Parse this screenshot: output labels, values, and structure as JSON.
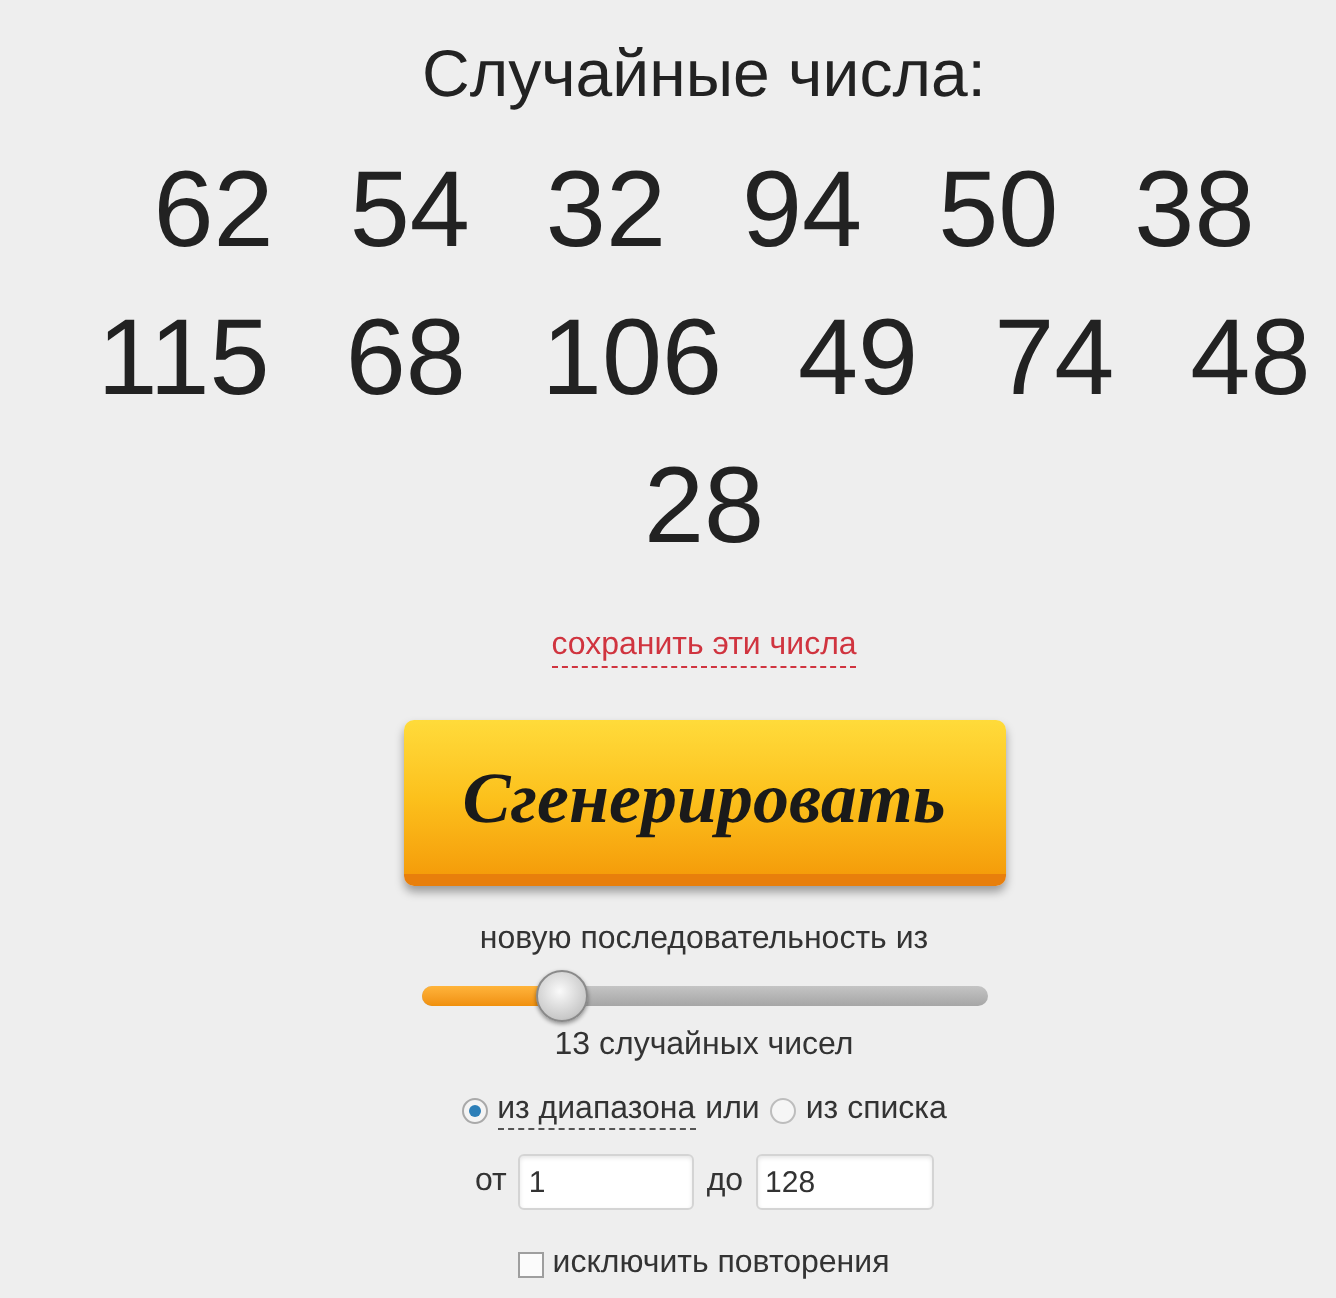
{
  "title": "Случайные числа:",
  "numbers": [
    "62",
    "54",
    "32",
    "94",
    "50",
    "38",
    "115",
    "68",
    "106",
    "49",
    "74",
    "48",
    "28"
  ],
  "save_link": "сохранить эти числа",
  "generate_button": "Сгенерировать",
  "count_prefix": "новую последовательность из",
  "count_slider": {
    "level": 0.25
  },
  "count_label": "13 случайных чисел",
  "source": {
    "options": [
      {
        "label": "из диапазона",
        "selected": true
      },
      {
        "label": "из списка",
        "selected": false
      }
    ],
    "conjunction": "или"
  },
  "range": {
    "from_label": "от",
    "from_value": "1",
    "to_label": "до",
    "to_value": "128"
  },
  "exclude_repeats": {
    "label": "исключить повторения",
    "checked": false
  }
}
